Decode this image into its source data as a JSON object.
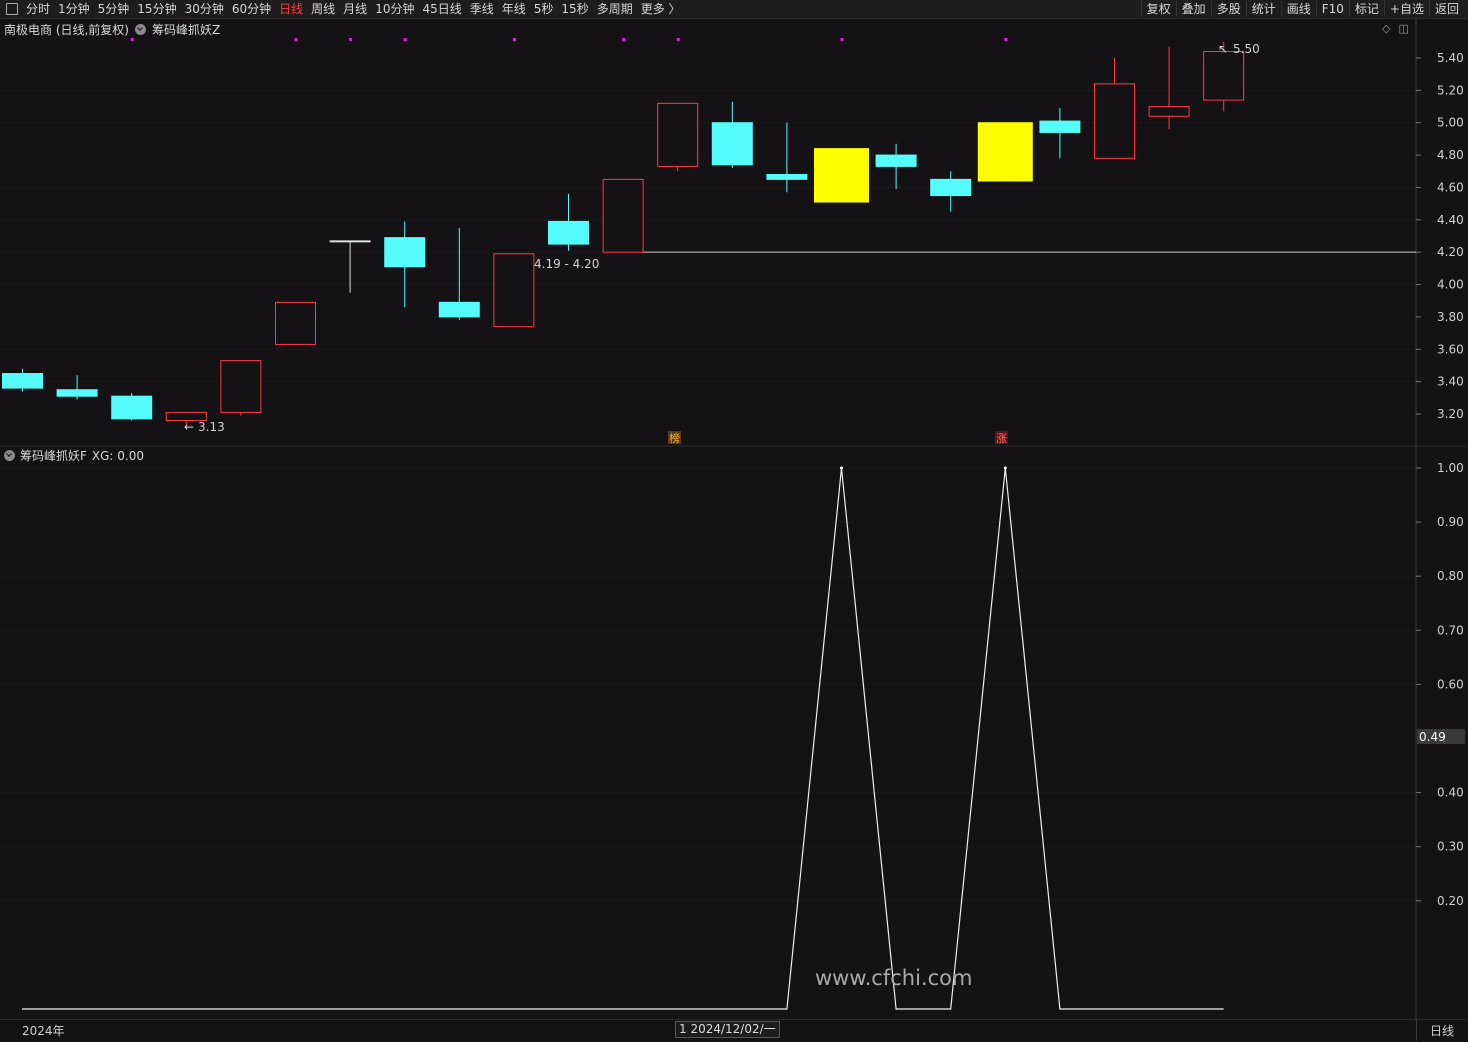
{
  "toolbar": {
    "tabs": [
      "分时",
      "1分钟",
      "5分钟",
      "15分钟",
      "30分钟",
      "60分钟",
      "日线",
      "周线",
      "月线",
      "10分钟",
      "45日线",
      "季线",
      "年线",
      "5秒",
      "15秒",
      "多周期",
      "更多 〉"
    ],
    "active_tab": "日线",
    "right_tools": [
      "复权",
      "叠加",
      "多股",
      "统计",
      "画线",
      "F10",
      "标记",
      "+自选",
      "返回"
    ]
  },
  "price_panel": {
    "stock_title": "南极电商 (日线,前复权)",
    "indicator_name": "筹码峰抓妖Z"
  },
  "osc_panel": {
    "indicator_name": "筹码峰抓妖F",
    "xg_readout": "XG: 0.00",
    "cursor_value": "0.49"
  },
  "footer": {
    "year_label": "2024年",
    "cursor_date": "1 2024/12/02/一",
    "period_label": "日线"
  },
  "watermark": "www.cfchi.com",
  "chart_data": [
    {
      "type": "candlestick",
      "y_ticks": [
        "5.40",
        "5.20",
        "5.00",
        "4.80",
        "4.60",
        "4.40",
        "4.20",
        "4.00",
        "3.80",
        "3.60",
        "3.40",
        "3.20"
      ],
      "ylim": [
        3.08,
        5.62
      ],
      "candles": [
        {
          "open": 3.45,
          "close": 3.36,
          "high": 3.48,
          "low": 3.34,
          "color": "cyan"
        },
        {
          "open": 3.35,
          "close": 3.31,
          "high": 3.44,
          "low": 3.29,
          "color": "cyan"
        },
        {
          "open": 3.31,
          "close": 3.17,
          "high": 3.33,
          "low": 3.16,
          "color": "cyan"
        },
        {
          "open": 3.16,
          "close": 3.21,
          "high": 3.21,
          "low": 3.13,
          "color": "red"
        },
        {
          "open": 3.21,
          "close": 3.53,
          "high": 3.53,
          "low": 3.19,
          "color": "red"
        },
        {
          "open": 3.63,
          "close": 3.89,
          "high": 3.89,
          "low": 3.63,
          "color": "red"
        },
        {
          "open": 4.27,
          "close": 4.27,
          "high": 4.27,
          "low": 3.95,
          "color": "white"
        },
        {
          "open": 4.29,
          "close": 4.11,
          "high": 4.39,
          "low": 3.86,
          "color": "cyan"
        },
        {
          "open": 3.89,
          "close": 3.8,
          "high": 4.35,
          "low": 3.78,
          "color": "cyan"
        },
        {
          "open": 3.74,
          "close": 4.19,
          "high": 4.19,
          "low": 3.74,
          "color": "red"
        },
        {
          "open": 4.39,
          "close": 4.25,
          "high": 4.56,
          "low": 4.21,
          "color": "cyan"
        },
        {
          "open": 4.2,
          "close": 4.65,
          "high": 4.65,
          "low": 4.2,
          "color": "red"
        },
        {
          "open": 4.73,
          "close": 5.12,
          "high": 5.12,
          "low": 4.7,
          "color": "red"
        },
        {
          "open": 5.0,
          "close": 4.74,
          "high": 5.13,
          "low": 4.72,
          "color": "cyan"
        },
        {
          "open": 4.68,
          "close": 4.65,
          "high": 5.0,
          "low": 4.57,
          "color": "cyan"
        },
        {
          "open": 4.84,
          "close": 4.51,
          "high": 4.84,
          "low": 4.51,
          "color": "yellow"
        },
        {
          "open": 4.8,
          "close": 4.73,
          "high": 4.87,
          "low": 4.59,
          "color": "cyan"
        },
        {
          "open": 4.65,
          "close": 4.55,
          "high": 4.7,
          "low": 4.45,
          "color": "cyan"
        },
        {
          "open": 4.64,
          "close": 5.0,
          "high": 5.0,
          "low": 4.64,
          "color": "yellow"
        },
        {
          "open": 5.01,
          "close": 4.94,
          "high": 5.09,
          "low": 4.78,
          "color": "cyan"
        },
        {
          "open": 4.78,
          "close": 5.24,
          "high": 5.4,
          "low": 4.78,
          "color": "red"
        },
        {
          "open": 5.04,
          "close": 5.1,
          "high": 5.47,
          "low": 4.96,
          "color": "red"
        },
        {
          "open": 5.14,
          "close": 5.44,
          "high": 5.5,
          "low": 5.07,
          "color": "red"
        }
      ],
      "horizontal_line": 4.2,
      "annotations": {
        "low_label": "3.13",
        "high_label": "5.50",
        "range_label": "4.19 - 4.20",
        "marker_bang": "榜",
        "marker_zhang": "涨"
      },
      "top_dot_indices": [
        2,
        5,
        6,
        7,
        9,
        11,
        12,
        15,
        18
      ]
    },
    {
      "type": "line",
      "name": "XG",
      "y_ticks": [
        "1.00",
        "0.90",
        "0.80",
        "0.70",
        "0.60",
        "0.40",
        "0.30",
        "0.20"
      ],
      "ylim": [
        0,
        1
      ],
      "values": [
        0,
        0,
        0,
        0,
        0,
        0,
        0,
        0,
        0,
        0,
        0,
        0,
        0,
        0,
        0,
        1,
        0,
        0,
        1,
        0,
        0,
        0,
        0
      ]
    }
  ]
}
